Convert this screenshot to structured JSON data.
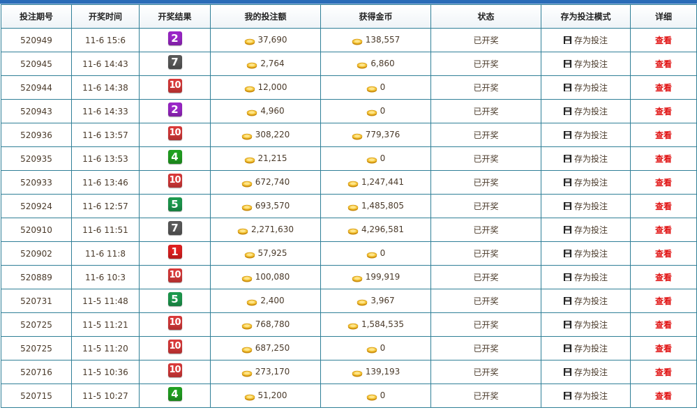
{
  "colors": {
    "1": "#e02020",
    "2": "#9b26c8",
    "4": "#21a121",
    "5": "#1d9a4e",
    "7": "#5a5a5a",
    "10": "#d93a3a",
    "detail": "#e01010"
  },
  "headers": [
    "投注期号",
    "开奖时间",
    "开奖结果",
    "我的投注额",
    "获得金币",
    "状态",
    "存为投注模式",
    "详细"
  ],
  "rows": [
    {
      "period": "520949",
      "time": "11-6 15:6",
      "result": "2",
      "bet": "37,690",
      "won": "138,557",
      "status": "已开奖",
      "save": "存为投注",
      "detail": "查看"
    },
    {
      "period": "520945",
      "time": "11-6 14:43",
      "result": "7",
      "bet": "2,764",
      "won": "6,860",
      "status": "已开奖",
      "save": "存为投注",
      "detail": "查看"
    },
    {
      "period": "520944",
      "time": "11-6 14:38",
      "result": "10",
      "bet": "12,000",
      "won": "0",
      "status": "已开奖",
      "save": "存为投注",
      "detail": "查看"
    },
    {
      "period": "520943",
      "time": "11-6 14:33",
      "result": "2",
      "bet": "4,960",
      "won": "0",
      "status": "已开奖",
      "save": "存为投注",
      "detail": "查看"
    },
    {
      "period": "520936",
      "time": "11-6 13:57",
      "result": "10",
      "bet": "308,220",
      "won": "779,376",
      "status": "已开奖",
      "save": "存为投注",
      "detail": "查看"
    },
    {
      "period": "520935",
      "time": "11-6 13:53",
      "result": "4",
      "bet": "21,215",
      "won": "0",
      "status": "已开奖",
      "save": "存为投注",
      "detail": "查看"
    },
    {
      "period": "520933",
      "time": "11-6 13:46",
      "result": "10",
      "bet": "672,740",
      "won": "1,247,441",
      "status": "已开奖",
      "save": "存为投注",
      "detail": "查看"
    },
    {
      "period": "520924",
      "time": "11-6 12:57",
      "result": "5",
      "bet": "693,570",
      "won": "1,485,805",
      "status": "已开奖",
      "save": "存为投注",
      "detail": "查看"
    },
    {
      "period": "520910",
      "time": "11-6 11:51",
      "result": "7",
      "bet": "2,271,630",
      "won": "4,296,581",
      "status": "已开奖",
      "save": "存为投注",
      "detail": "查看"
    },
    {
      "period": "520902",
      "time": "11-6 11:8",
      "result": "1",
      "bet": "57,925",
      "won": "0",
      "status": "已开奖",
      "save": "存为投注",
      "detail": "查看"
    },
    {
      "period": "520889",
      "time": "11-6 10:3",
      "result": "10",
      "bet": "100,080",
      "won": "199,919",
      "status": "已开奖",
      "save": "存为投注",
      "detail": "查看"
    },
    {
      "period": "520731",
      "time": "11-5 11:48",
      "result": "5",
      "bet": "2,400",
      "won": "3,967",
      "status": "已开奖",
      "save": "存为投注",
      "detail": "查看"
    },
    {
      "period": "520725",
      "time": "11-5 11:21",
      "result": "10",
      "bet": "768,780",
      "won": "1,584,535",
      "status": "已开奖",
      "save": "存为投注",
      "detail": "查看"
    },
    {
      "period": "520725",
      "time": "11-5 11:20",
      "result": "10",
      "bet": "687,250",
      "won": "0",
      "status": "已开奖",
      "save": "存为投注",
      "detail": "查看"
    },
    {
      "period": "520716",
      "time": "11-5 10:36",
      "result": "10",
      "bet": "273,170",
      "won": "139,193",
      "status": "已开奖",
      "save": "存为投注",
      "detail": "查看"
    },
    {
      "period": "520715",
      "time": "11-5 10:27",
      "result": "4",
      "bet": "51,200",
      "won": "0",
      "status": "已开奖",
      "save": "存为投注",
      "detail": "查看"
    }
  ]
}
